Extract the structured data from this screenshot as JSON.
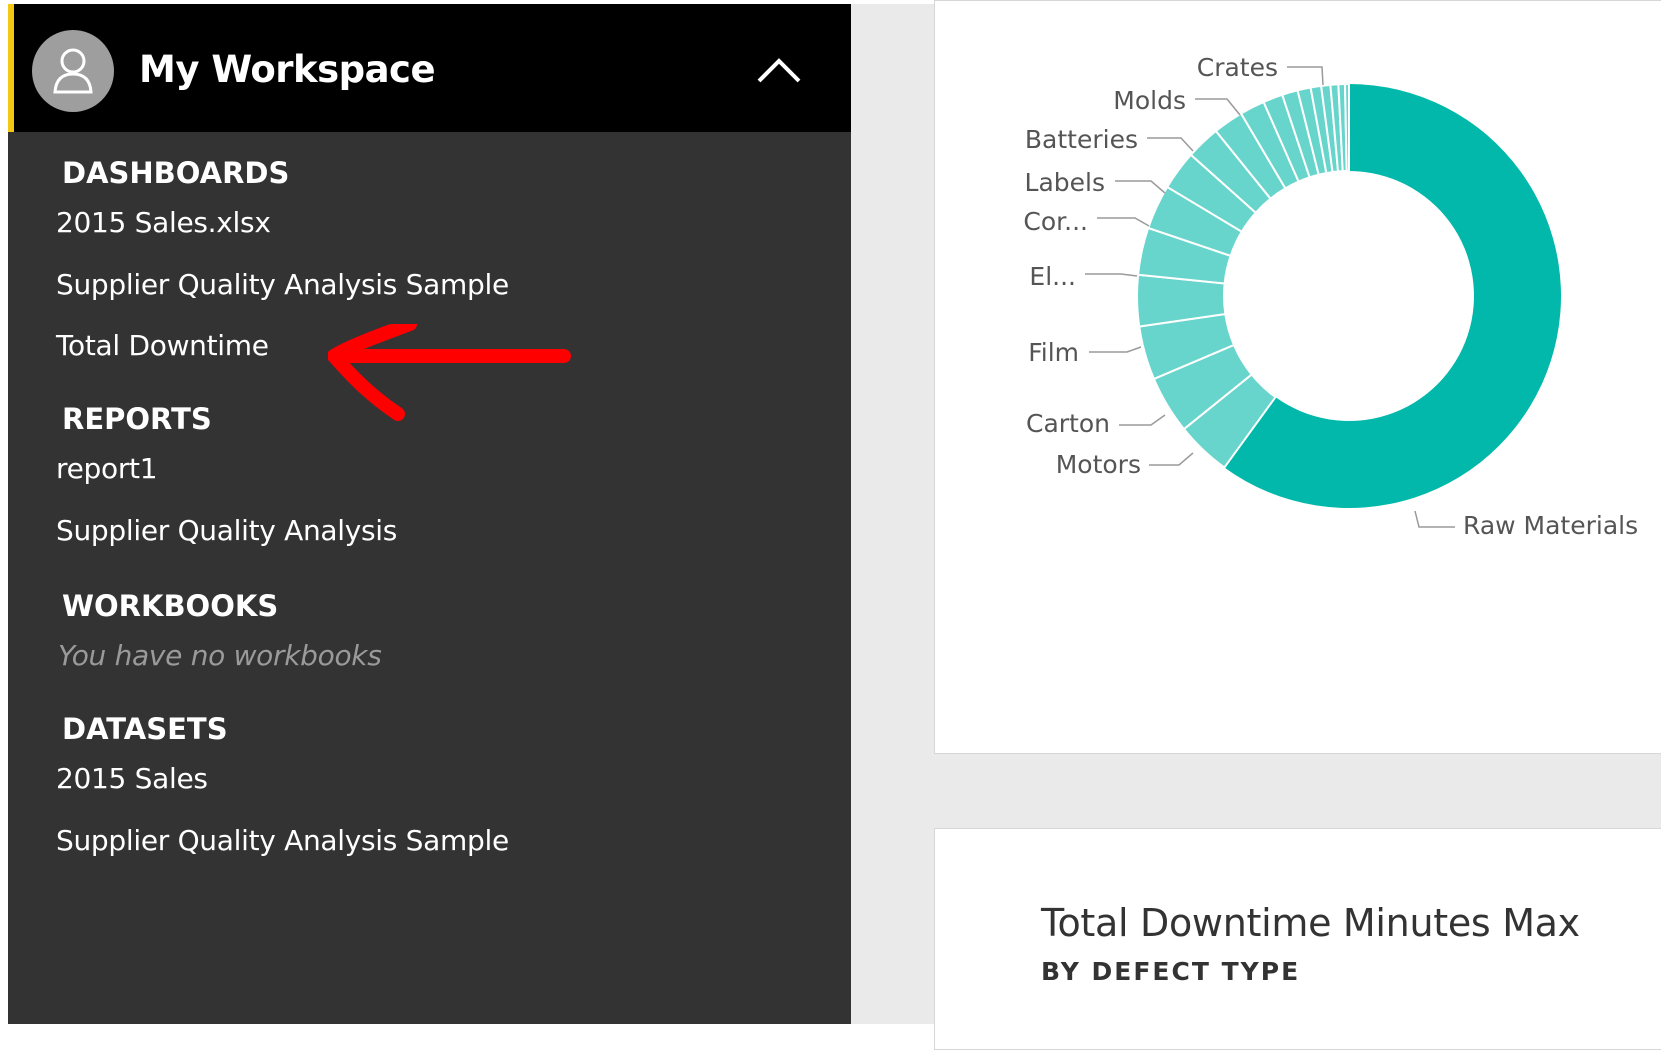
{
  "workspace": {
    "title": "My Workspace",
    "avatar_icon": "user-icon",
    "collapse_icon": "chevron-up-icon",
    "accent_color": "#f2c811"
  },
  "nav": {
    "dashboards": {
      "heading": "DASHBOARDS",
      "items": [
        "2015 Sales.xlsx",
        "Supplier Quality Analysis Sample",
        "Total Downtime"
      ]
    },
    "reports": {
      "heading": "REPORTS",
      "items": [
        "report1",
        "Supplier Quality Analysis"
      ]
    },
    "workbooks": {
      "heading": "WORKBOOKS",
      "empty": "You have no workbooks"
    },
    "datasets": {
      "heading": "DATASETS",
      "items": [
        "2015 Sales",
        "Supplier Quality Analysis Sample"
      ]
    }
  },
  "annotation": {
    "icon": "red-arrow-icon",
    "color": "#ff0000"
  },
  "tile2": {
    "title": "Total Downtime Minutes Max",
    "subtitle": "BY DEFECT TYPE"
  },
  "chart_data": {
    "type": "pie",
    "donut": true,
    "colors": {
      "primary": "#01b8aa",
      "secondary": "#67d5cc"
    },
    "labels": [
      "Raw Materials",
      "Motors",
      "Carton",
      "Film",
      "El...",
      "Cor...",
      "Labels",
      "Batteries",
      "Molds",
      "Crates"
    ],
    "slices": [
      {
        "label": "Raw Materials",
        "value": 60.0
      },
      {
        "label": "Motors",
        "value": 4.2
      },
      {
        "label": "Carton",
        "value": 4.4
      },
      {
        "label": "Film",
        "value": 4.1
      },
      {
        "label": "El...",
        "value": 3.9
      },
      {
        "label": "Cor...",
        "value": 3.6
      },
      {
        "label": "Labels",
        "value": 3.4
      },
      {
        "label": "Batteries",
        "value": 3.0
      },
      {
        "label": "",
        "value": 2.6
      },
      {
        "label": "Molds",
        "value": 2.3
      },
      {
        "label": "Crates",
        "value": 1.9
      },
      {
        "label": "",
        "value": 1.5
      },
      {
        "label": "",
        "value": 1.2
      },
      {
        "label": "",
        "value": 1.0
      },
      {
        "label": "",
        "value": 0.8
      },
      {
        "label": "",
        "value": 0.7
      },
      {
        "label": "",
        "value": 0.6
      },
      {
        "label": "",
        "value": 0.5
      },
      {
        "label": "",
        "value": 0.3
      }
    ]
  }
}
